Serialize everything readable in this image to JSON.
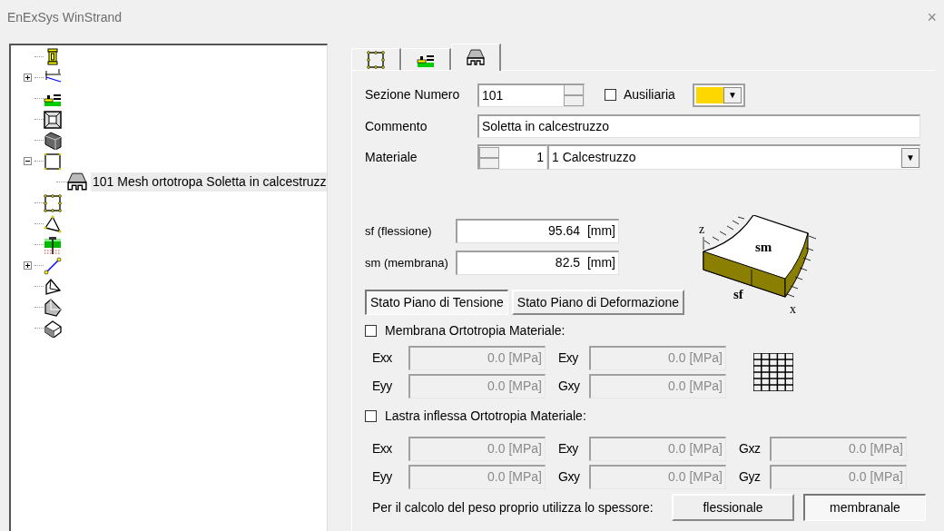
{
  "window": {
    "title": "EnExSys WinStrand",
    "close": "×"
  },
  "tree": [
    {
      "kind": "column"
    },
    {
      "kind": "beam-load",
      "expanded": false
    },
    {
      "kind": "section"
    },
    {
      "kind": "frame"
    },
    {
      "kind": "block"
    },
    {
      "kind": "square",
      "expanded": true,
      "children": [
        {
          "kind": "mesh",
          "label": "101 Mesh ortotropa Soletta in calcestruzz",
          "selected": true
        }
      ]
    },
    {
      "kind": "nodes"
    },
    {
      "kind": "triangle"
    },
    {
      "kind": "soil"
    },
    {
      "kind": "line",
      "expanded": false
    },
    {
      "kind": "solid-a"
    },
    {
      "kind": "solid-b"
    },
    {
      "kind": "solid-c"
    }
  ],
  "tabs": [
    {
      "kind": "nodes",
      "selected": false
    },
    {
      "kind": "section",
      "selected": false
    },
    {
      "kind": "mesh",
      "selected": true
    }
  ],
  "sezione": {
    "label": "Sezione Numero",
    "value": "101"
  },
  "ausiliaria": {
    "label": "Ausiliaria",
    "checked": false,
    "color": "#ffd700",
    "caret": "▼"
  },
  "commento": {
    "label": "Commento",
    "value": "Soletta in calcestruzzo"
  },
  "materiale": {
    "label": "Materiale",
    "number": "1",
    "value": "1 Calcestruzzo",
    "caret": "▼"
  },
  "thickness": [
    {
      "label": "sf (flessione)",
      "value": "95.64  [mm]"
    },
    {
      "label": "sm (membrana)",
      "value": "82.5  [mm]"
    }
  ],
  "state_buttons": [
    {
      "label": "Stato Piano di Tensione",
      "selected": true
    },
    {
      "label": "Stato Piano di Deformazione",
      "selected": false
    }
  ],
  "slab_labels": {
    "z": "z",
    "sm": "sm",
    "sf": "sf",
    "x": "x"
  },
  "membrana": {
    "label": "Membrana Ortotropia Materiale:",
    "checked": false,
    "rows": [
      [
        {
          "label": "Exx",
          "value": "0.0 [MPa]"
        },
        {
          "label": "Exy",
          "value": "0.0 [MPa]"
        }
      ],
      [
        {
          "label": "Eyy",
          "value": "0.0 [MPa]"
        },
        {
          "label": "Gxy",
          "value": "0.0 [MPa]"
        }
      ]
    ]
  },
  "lastra": {
    "label": "Lastra inflessa Ortotropia Materiale:",
    "checked": false,
    "rows": [
      [
        {
          "label": "Exx",
          "value": "0.0 [MPa]"
        },
        {
          "label": "Exy",
          "value": "0.0 [MPa]"
        },
        {
          "label": "Gxz",
          "value": "0.0 [MPa]"
        }
      ],
      [
        {
          "label": "Eyy",
          "value": "0.0 [MPa]"
        },
        {
          "label": "Gxy",
          "value": "0.0 [MPa]"
        },
        {
          "label": "Gyz",
          "value": "0.0 [MPa]"
        }
      ]
    ]
  },
  "peso": {
    "label": "Per il calcolo del peso proprio utilizza lo spessore:",
    "options": [
      {
        "label": "flessionale",
        "selected": false
      },
      {
        "label": "membranale",
        "selected": true
      }
    ]
  },
  "fields_disabled": true
}
